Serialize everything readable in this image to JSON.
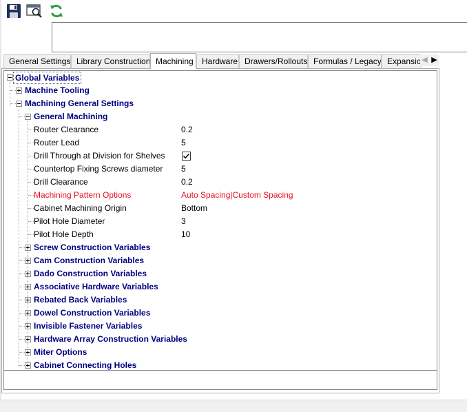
{
  "toolbar": {
    "buttons": [
      {
        "icon": "save-icon"
      },
      {
        "icon": "print-preview-icon"
      },
      {
        "icon": "refresh-icon"
      }
    ]
  },
  "notes": {
    "value": "",
    "placeholder": ""
  },
  "tabs": [
    {
      "label": "General Settings",
      "active": false
    },
    {
      "label": "Library Construction",
      "active": false
    },
    {
      "label": "Machining",
      "active": true
    },
    {
      "label": "Hardware",
      "active": false
    },
    {
      "label": "Drawers/Rollouts",
      "active": false
    },
    {
      "label": "Formulas / Legacy",
      "active": false
    },
    {
      "label": "Expansion",
      "active": false
    }
  ],
  "tab_scroll": {
    "left": "◀",
    "right": "▶"
  },
  "tree": {
    "root": "Global Variables",
    "machine_tooling": "Machine Tooling",
    "machining_general_settings": "Machining General Settings",
    "general_machining": "General Machining",
    "properties": [
      {
        "name": "Router Clearance",
        "value": "0.2",
        "highlight": false
      },
      {
        "name": "Router Lead",
        "value": "5",
        "highlight": false
      },
      {
        "name": "Drill Through at Division for Shelves",
        "value": "",
        "checked": true,
        "highlight": false
      },
      {
        "name": "Countertop Fixing Screws diameter",
        "value": "5",
        "highlight": false
      },
      {
        "name": "Drill Clearance",
        "value": "0.2",
        "highlight": false
      },
      {
        "name": "Machining Pattern Options",
        "value": "Auto Spacing|Custom Spacing",
        "highlight": true
      },
      {
        "name": "Cabinet Machining Origin",
        "value": "Bottom",
        "highlight": false
      },
      {
        "name": "Pilot Hole Diameter",
        "value": "3",
        "highlight": false
      },
      {
        "name": "Pilot Hole Depth",
        "value": "10",
        "highlight": false
      }
    ],
    "groups": [
      "Screw Construction Variables",
      "Cam Construction Variables",
      "Dado Construction Variables",
      "Associative Hardware Variables",
      "Rebated Back Variables",
      "Dowel Construction Variables",
      "Invisible Fastener Variables",
      "Hardware Array Construction Variables",
      "Miter Options",
      "Cabinet Connecting Holes"
    ]
  },
  "colors": {
    "node_text": "#000080",
    "highlight_text": "#e81123",
    "save_icon": "#1f2f5a",
    "refresh_icon": "#2e9e3a"
  }
}
